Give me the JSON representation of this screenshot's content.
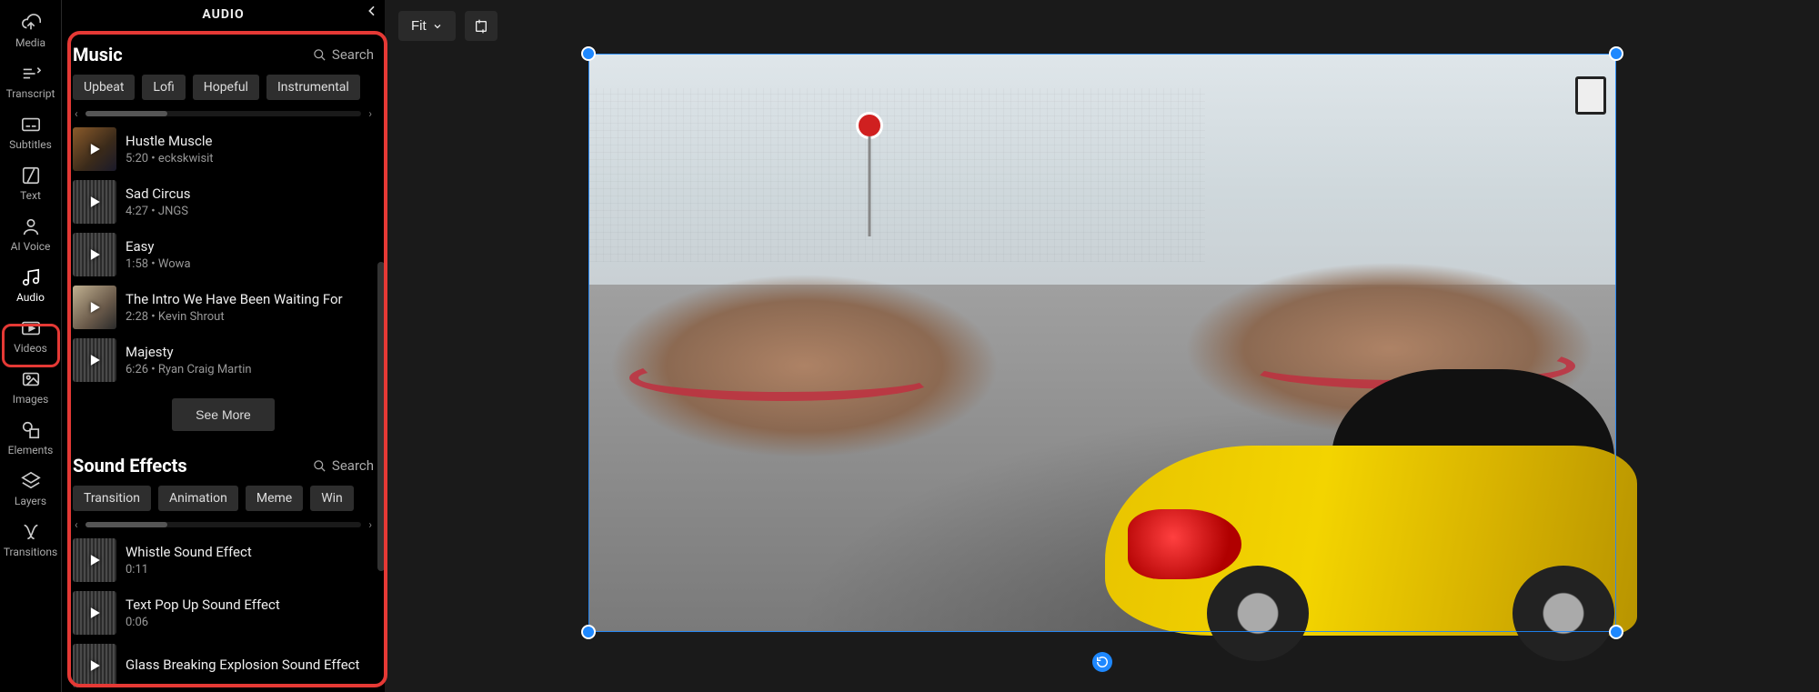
{
  "nav": [
    {
      "id": "media",
      "label": "Media"
    },
    {
      "id": "transcript",
      "label": "Transcript"
    },
    {
      "id": "subtitles",
      "label": "Subtitles"
    },
    {
      "id": "text",
      "label": "Text"
    },
    {
      "id": "ai-voice",
      "label": "AI Voice"
    },
    {
      "id": "audio",
      "label": "Audio",
      "active": true
    },
    {
      "id": "videos",
      "label": "Videos"
    },
    {
      "id": "images",
      "label": "Images"
    },
    {
      "id": "elements",
      "label": "Elements"
    },
    {
      "id": "layers",
      "label": "Layers"
    },
    {
      "id": "transitions",
      "label": "Transitions"
    }
  ],
  "panel": {
    "title": "AUDIO"
  },
  "music": {
    "title": "Music",
    "search_label": "Search",
    "chips": [
      "Upbeat",
      "Lofi",
      "Hopeful",
      "Instrumental"
    ],
    "tracks": [
      {
        "title": "Hustle Muscle",
        "duration": "5:20",
        "artist": "eckskwisit",
        "thumb": "image-a"
      },
      {
        "title": "Sad Circus",
        "duration": "4:27",
        "artist": "JNGS",
        "thumb": "waveform"
      },
      {
        "title": "Easy",
        "duration": "1:58",
        "artist": "Wowa",
        "thumb": "waveform"
      },
      {
        "title": "The Intro We Have Been Waiting For",
        "duration": "2:28",
        "artist": "Kevin Shrout",
        "thumb": "image-b"
      },
      {
        "title": "Majesty",
        "duration": "6:26",
        "artist": "Ryan Craig Martin",
        "thumb": "waveform"
      }
    ],
    "see_more": "See More"
  },
  "sfx": {
    "title": "Sound Effects",
    "search_label": "Search",
    "chips": [
      "Transition",
      "Animation",
      "Meme",
      "Win"
    ],
    "tracks": [
      {
        "title": "Whistle Sound Effect",
        "duration": "0:11",
        "thumb": "waveform"
      },
      {
        "title": "Text Pop Up Sound Effect",
        "duration": "0:06",
        "thumb": "waveform"
      },
      {
        "title": "Glass Breaking Explosion Sound Effect",
        "duration": "",
        "thumb": "waveform"
      }
    ]
  },
  "toolbar": {
    "fit_label": "Fit"
  },
  "highlight": {
    "color": "#e53935"
  }
}
